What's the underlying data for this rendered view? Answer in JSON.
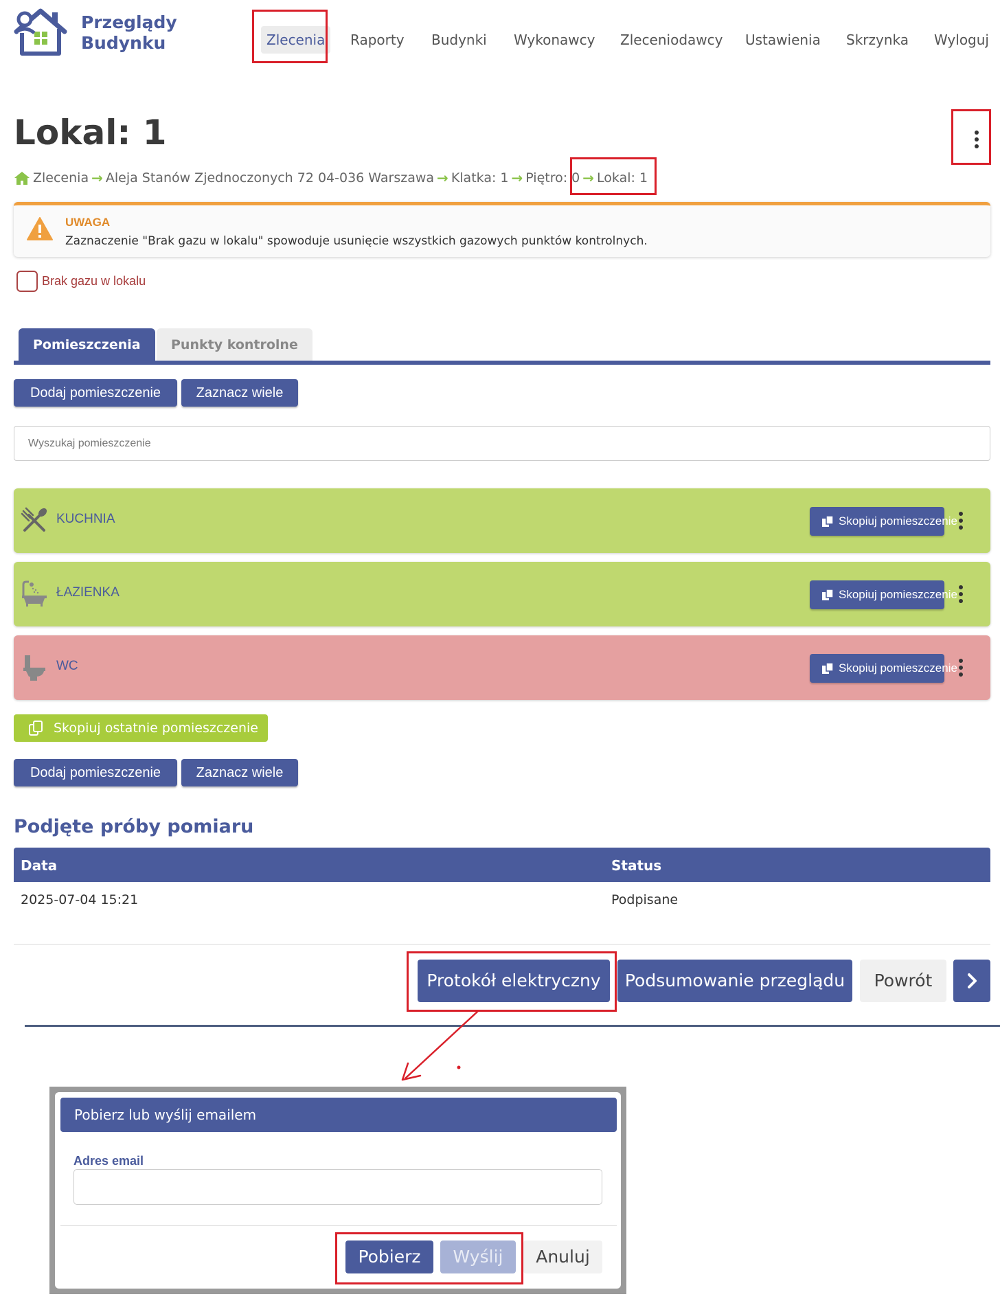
{
  "header": {
    "logo_line1": "Przeglądy",
    "logo_line2": "Budynku",
    "nav": [
      "Zlecenia",
      "Raporty",
      "Budynki",
      "Wykonawcy",
      "Zleceniodawcy",
      "Ustawienia",
      "Skrzynka",
      "Wyloguj"
    ],
    "active_nav": "Zlecenia"
  },
  "page": {
    "title": "Lokal: 1",
    "breadcrumb": [
      "Zlecenia",
      "Aleja Stanów Zjednoczonych 72 04-036 Warszawa",
      "Klatka: 1",
      "Piętro: 0",
      "Lokal: 1"
    ]
  },
  "alert": {
    "title": "UWAGA",
    "text": "Zaznaczenie \"Brak gazu w lokalu\" spowoduje usunięcie wszystkich gazowych punktów kontrolnych."
  },
  "checkbox": {
    "label": "Brak gazu w lokalu",
    "checked": false
  },
  "tabs": [
    {
      "label": "Pomieszczenia",
      "active": true
    },
    {
      "label": "Punkty kontrolne",
      "active": false
    }
  ],
  "actions": {
    "add_room": "Dodaj pomieszczenie",
    "select_many": "Zaznacz wiele"
  },
  "search": {
    "placeholder": "Wyszukaj pomieszczenie",
    "value": ""
  },
  "rooms": [
    {
      "name": "KUCHNIA",
      "icon": "utensils-icon",
      "status": "ok",
      "copy_label": "Skopiuj pomieszczenie"
    },
    {
      "name": "ŁAZIENKA",
      "icon": "bathtub-icon",
      "status": "ok",
      "copy_label": "Skopiuj pomieszczenie"
    },
    {
      "name": "WC",
      "icon": "toilet-icon",
      "status": "error",
      "copy_label": "Skopiuj pomieszczenie"
    }
  ],
  "copy_last": "Skopiuj ostatnie pomieszczenie",
  "measurements": {
    "title": "Podjęte próby pomiaru",
    "columns": [
      "Data",
      "Status"
    ],
    "rows": [
      [
        "2025-07-04 15:21",
        "Podpisane"
      ]
    ]
  },
  "footer_buttons": {
    "protocol": "Protokół elektryczny",
    "summary": "Podsumowanie przeglądu",
    "back": "Powrót",
    "next_icon": "chevron-right-icon"
  },
  "modal": {
    "title": "Pobierz lub wyślij emailem",
    "email_label": "Adres email",
    "email_value": "",
    "download": "Pobierz",
    "send": "Wyślij",
    "cancel": "Anuluj"
  },
  "colors": {
    "brand": "#4a5b9c",
    "room_ok": "#bfd86f",
    "room_error": "#e5a0a0",
    "warning": "#f0a040",
    "annotation": "#d9202a"
  }
}
